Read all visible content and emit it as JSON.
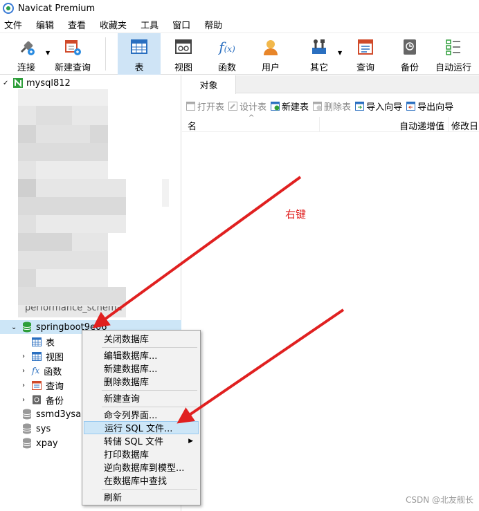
{
  "window": {
    "title": "Navicat Premium"
  },
  "menu": [
    "文件",
    "编辑",
    "查看",
    "收藏夹",
    "工具",
    "窗口",
    "帮助"
  ],
  "toolbar": {
    "connect": "连接",
    "new_query": "新建查询",
    "table": "表",
    "view": "视图",
    "function": "函数",
    "user": "用户",
    "other": "其它",
    "query": "查询",
    "backup": "备份",
    "automation": "自动运行",
    "active": "表"
  },
  "tree": {
    "connection": "mysql812",
    "partial_db": "performance_schema",
    "selected_db": "springboot9e06",
    "children": {
      "table": "表",
      "view": "视图",
      "function": "函数",
      "query": "查询",
      "backup": "备份"
    },
    "other_dbs": [
      "ssmd3ysa",
      "sys",
      "xpay"
    ]
  },
  "objects_tab": {
    "label": "对象"
  },
  "object_toolbar": {
    "open_table": "打开表",
    "design_table": "设计表",
    "new_table": "新建表",
    "delete_table": "删除表",
    "import_wizard": "导入向导",
    "export_wizard": "导出向导"
  },
  "columns": {
    "name": "名",
    "auto_increment": "自动递增值",
    "modified": "修改日"
  },
  "context_menu": {
    "close_db": "关闭数据库",
    "edit_db": "编辑数据库...",
    "new_db": "新建数据库...",
    "delete_db": "删除数据库",
    "new_query": "新建查询",
    "console": "命令列界面...",
    "run_sql": "运行 SQL 文件...",
    "dump_sql": "转储 SQL 文件",
    "print_db": "打印数据库",
    "reverse_model": "逆向数据库到模型...",
    "find_in_db": "在数据库中查找",
    "refresh": "刷新",
    "highlighted": "运行 SQL 文件..."
  },
  "annotation": {
    "text": "右键"
  },
  "watermark": "CSDN @北友舰长",
  "colors": {
    "annotation_red": "#e02020",
    "highlight": "#cde6f7",
    "db_green": "#2e9e3a"
  }
}
